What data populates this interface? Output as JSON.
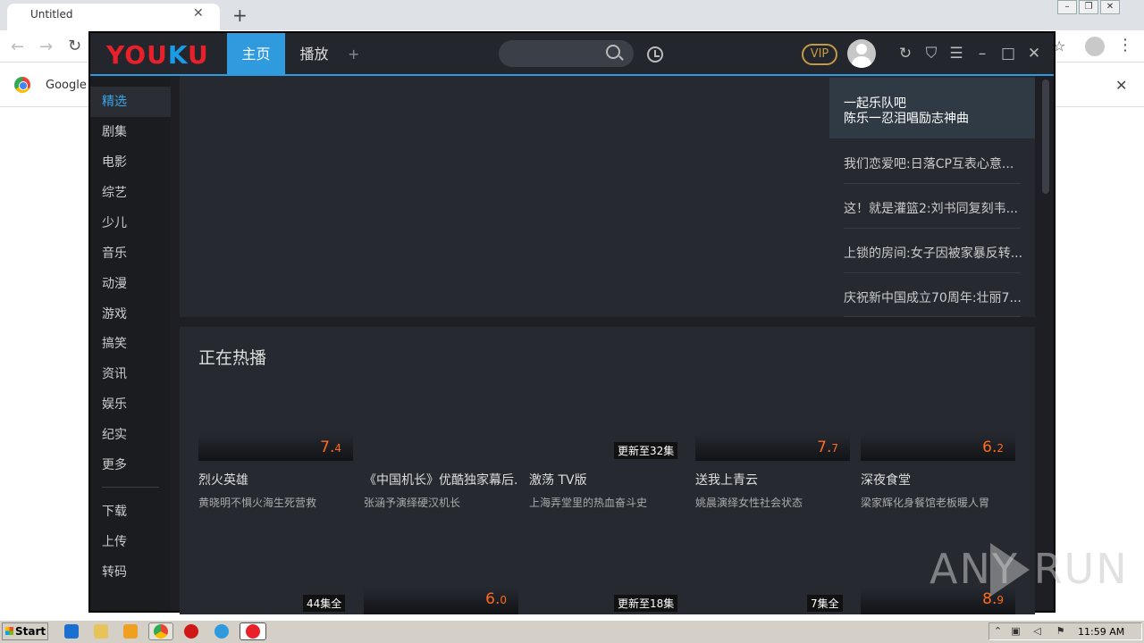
{
  "browser": {
    "tab_title": "Untitled",
    "tab_close": "✕",
    "new_tab": "+",
    "infobar_text": "Google C",
    "infobar_close": "✕"
  },
  "window_controls": [
    "–",
    "❐",
    "✕"
  ],
  "youku": {
    "tabs": {
      "home": "主页",
      "play": "播放",
      "add": "+"
    },
    "vip": "VIP",
    "sidebar": [
      {
        "label": "精选",
        "active": true
      },
      {
        "label": "剧集"
      },
      {
        "label": "电影"
      },
      {
        "label": "综艺"
      },
      {
        "label": "少儿"
      },
      {
        "label": "音乐"
      },
      {
        "label": "动漫"
      },
      {
        "label": "游戏"
      },
      {
        "label": "搞笑"
      },
      {
        "label": "资讯"
      },
      {
        "label": "娱乐"
      },
      {
        "label": "纪实"
      },
      {
        "label": "更多"
      }
    ],
    "sidebar_tools": [
      "下载",
      "上传",
      "转码"
    ],
    "banner_list": {
      "active_line1": "一起乐队吧",
      "active_line2": "陈乐一忍泪唱励志神曲",
      "items": [
        "我们恋爱吧:日落CP互表心意...",
        "这！就是灌篮2:刘书同复刻韦...",
        "上锁的房间:女子因被家暴反转...",
        "庆祝新中国成立70周年:壮丽7..."
      ]
    },
    "hot": {
      "title": "正在热播",
      "cards": [
        {
          "score_int": "7.",
          "score_dec": "4",
          "badge": "",
          "title": "烈火英雄",
          "sub": "黄晓明不惧火海生死营救"
        },
        {
          "score_int": "",
          "score_dec": "",
          "badge": "",
          "title": "《中国机长》优酷独家幕后...",
          "sub": "张涵予演绎硬汉机长"
        },
        {
          "score_int": "",
          "score_dec": "",
          "badge": "更新至32集",
          "title": "激荡 TV版",
          "sub": "上海弄堂里的热血奋斗史"
        },
        {
          "score_int": "7.",
          "score_dec": "7",
          "badge": "",
          "title": "送我上青云",
          "sub": "姚晨演绎女性社会状态"
        },
        {
          "score_int": "6.",
          "score_dec": "2",
          "badge": "",
          "title": "深夜食堂",
          "sub": "梁家辉化身餐馆老板暖人胃"
        }
      ],
      "row2": [
        {
          "score_int": "",
          "score_dec": "",
          "badge": "44集全"
        },
        {
          "score_int": "6.",
          "score_dec": "0",
          "badge": ""
        },
        {
          "score_int": "",
          "score_dec": "",
          "badge": "更新至18集"
        },
        {
          "score_int": "",
          "score_dec": "",
          "badge": "7集全"
        },
        {
          "score_int": "8.",
          "score_dec": "9",
          "badge": ""
        }
      ]
    }
  },
  "watermark": "ANY RUN",
  "taskbar": {
    "start": "Start",
    "clock": "11:59 AM"
  }
}
